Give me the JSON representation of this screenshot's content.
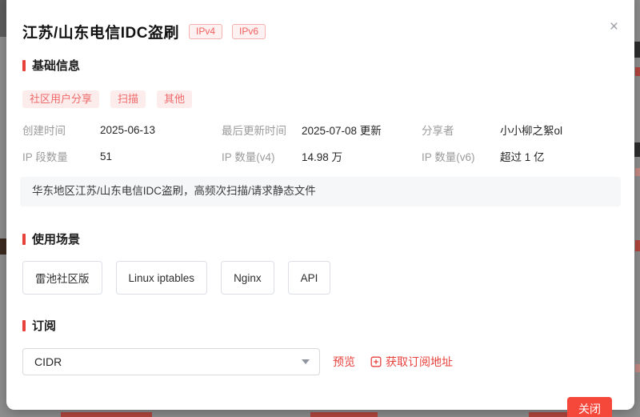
{
  "colors": {
    "accent_red": "#e8423d",
    "primary_button_red": "#f5483b",
    "tag_background": "#fdecec",
    "tag_text": "#ef6a6a",
    "badge_border": "#f3b1b1",
    "label_gray": "#9b9b9b",
    "overlay_gray": "#8f8f8f",
    "description_background": "#f6f7f9"
  },
  "modal": {
    "title": "江苏/山东电信IDC盗刷",
    "badges": [
      {
        "label": "IPv4"
      },
      {
        "label": "IPv6"
      }
    ],
    "close_icon": "×",
    "sections": {
      "basic_info": {
        "heading": "基础信息",
        "tags": [
          "社区用户分享",
          "扫描",
          "其他"
        ],
        "fields": [
          {
            "label": "创建时间",
            "value": "2025-06-13"
          },
          {
            "label": "最后更新时间",
            "value": "2025-07-08 更新"
          },
          {
            "label": "分享者",
            "value": "小小柳之絮ol"
          },
          {
            "label": "IP 段数量",
            "value": "51"
          },
          {
            "label": "IP 数量(v4)",
            "value": "14.98 万"
          },
          {
            "label": "IP 数量(v6)",
            "value": "超过 1 亿"
          }
        ],
        "description": "华东地区江苏/山东电信IDC盗刷，高频次扫描/请求静态文件"
      },
      "usage": {
        "heading": "使用场景",
        "options": [
          "雷池社区版",
          "Linux iptables",
          "Nginx",
          "API"
        ]
      },
      "subscribe": {
        "heading": "订阅",
        "select_value": "CIDR",
        "preview_label": "预览",
        "get_url_label": "获取订阅地址"
      }
    },
    "footer": {
      "close_label": "关闭"
    }
  }
}
